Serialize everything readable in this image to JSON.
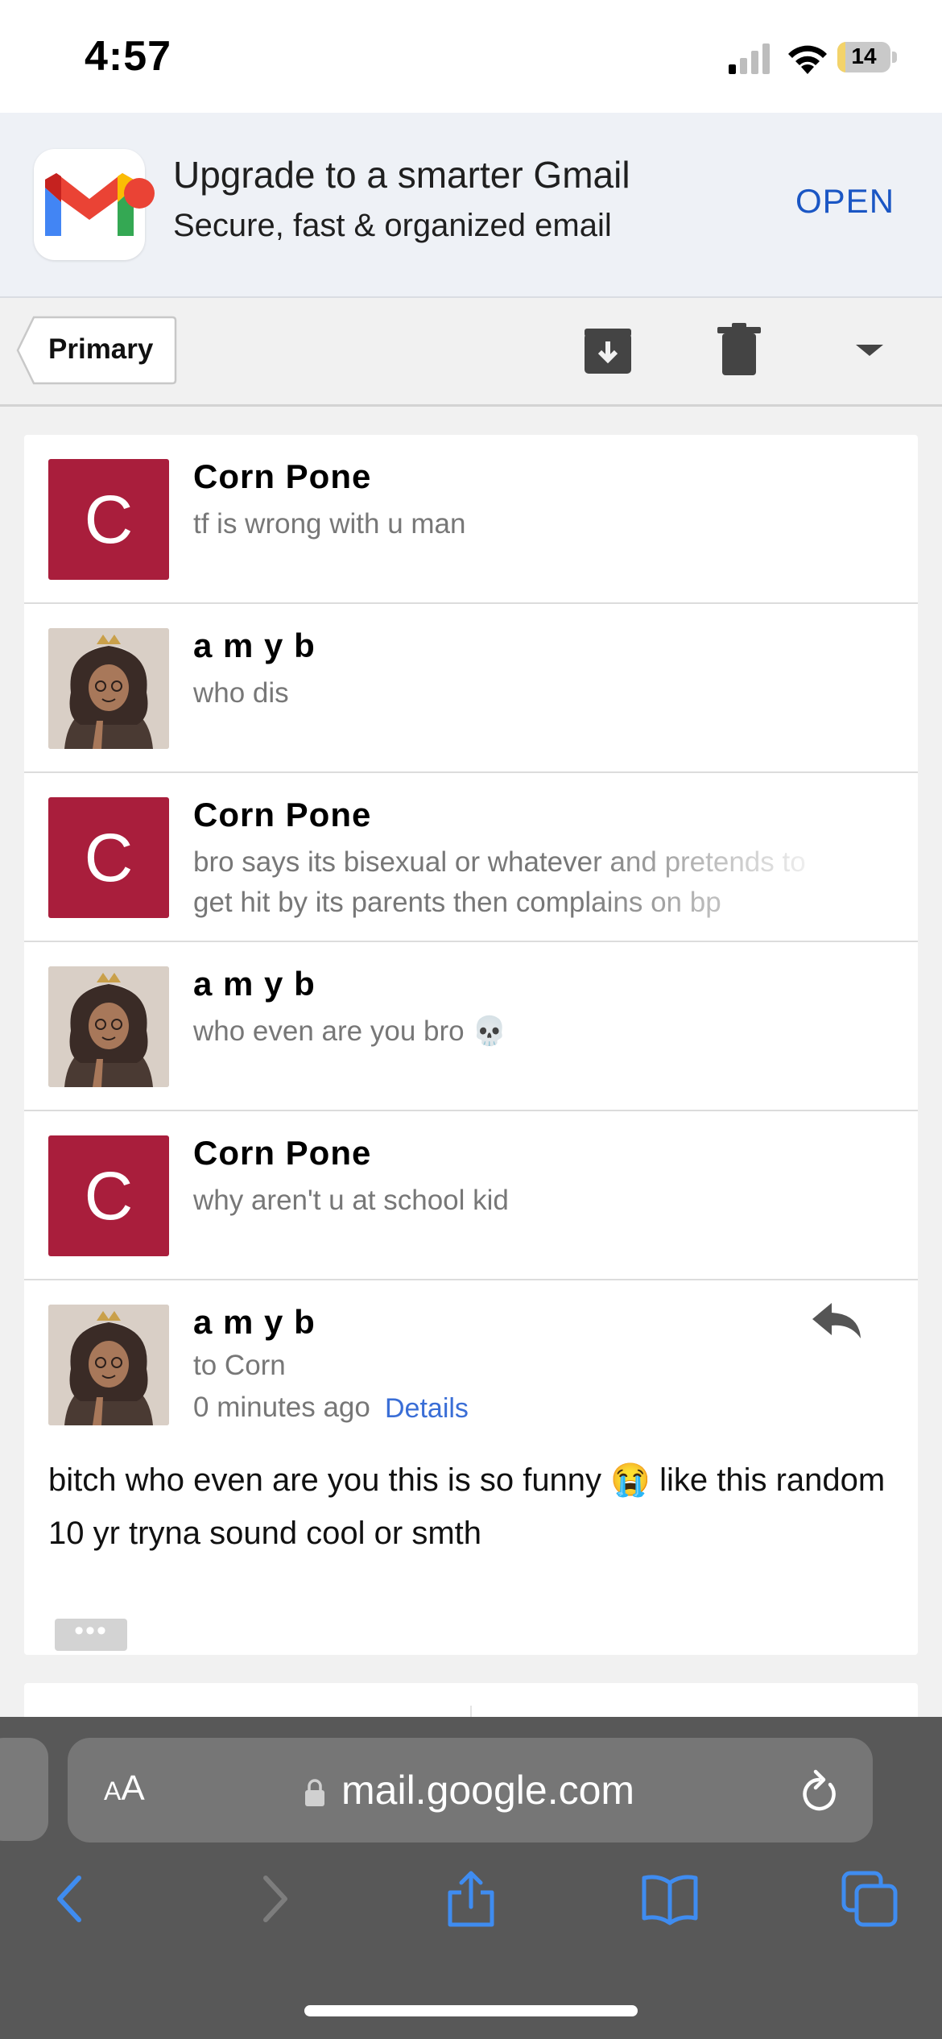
{
  "status_bar": {
    "time": "4:57",
    "battery_level": "14",
    "icons": [
      "cellular-signal-icon",
      "wifi-icon",
      "battery-charging-icon"
    ]
  },
  "banner": {
    "title": "Upgrade to a smarter Gmail",
    "subtitle": "Secure, fast & organized email",
    "open_label": "OPEN",
    "icon": "gmail-logo-icon"
  },
  "toolbar": {
    "back_label": "Primary",
    "icons": [
      "archive-icon",
      "trash-icon",
      "dropdown-caret-icon"
    ]
  },
  "messages": [
    {
      "sender": "Corn Pone",
      "avatar_letter": "C",
      "avatar_color": "#a91e3c",
      "snippet": "tf is wrong with u man"
    },
    {
      "sender": "a m y b",
      "avatar": "illustrated-avatar",
      "snippet": "who dis"
    },
    {
      "sender": "Corn Pone",
      "avatar_letter": "C",
      "avatar_color": "#a91e3c",
      "snippet": "bro says its bisexual or whatever and pretends to get hit by its parents then complains on bp"
    },
    {
      "sender": "a m y b",
      "avatar": "illustrated-avatar",
      "snippet": "who even are you bro 💀"
    },
    {
      "sender": "Corn Pone",
      "avatar_letter": "C",
      "avatar_color": "#a91e3c",
      "snippet": "why aren't u at school kid"
    }
  ],
  "expanded_message": {
    "sender": "a m y b",
    "to": "to Corn",
    "time": "0 minutes ago",
    "details_label": "Details",
    "body": "bitch who even are you this is so funny 😭 like this random 10 yr tryna sound cool or smth",
    "more_label": "•••"
  },
  "safari": {
    "text_size_label_large": "A",
    "text_size_label_small": "A",
    "url": "mail.google.com",
    "nav_icons": [
      "back-icon",
      "forward-icon",
      "share-icon",
      "bookmarks-icon",
      "tabs-icon"
    ]
  },
  "colors": {
    "accent_blue": "#1a56c4",
    "safari_blue": "#3f8cf0",
    "avatar_red": "#a91e3c"
  }
}
